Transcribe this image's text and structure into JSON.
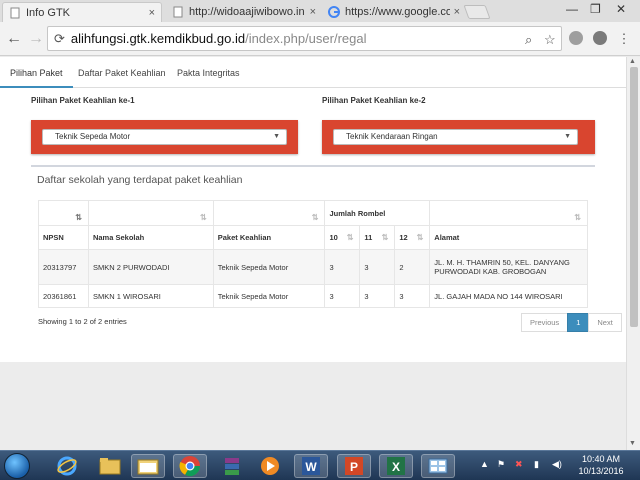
{
  "browser": {
    "tabs": [
      {
        "title": "Info GTK",
        "active": true
      },
      {
        "title": "http://widoaajiwibowo.in",
        "active": false
      },
      {
        "title": "https://www.google.co.id",
        "active": false
      }
    ],
    "close_glyph": "×",
    "url_host": "alihfungsi.gtk.kemdikbud.go.id",
    "url_path": "/index.php/user/regal"
  },
  "page": {
    "tabs": [
      "Pilihan Paket",
      "Daftar Paket Keahlian",
      "Pakta Integritas"
    ],
    "active_tab": 0,
    "choice1": {
      "label": "Pilihan Paket Keahlian ke-1",
      "value": "Teknik Sepeda Motor"
    },
    "choice2": {
      "label": "Pilihan Paket Keahlian ke-2",
      "value": "Teknik Kendaraan Ringan"
    },
    "list_title": "Daftar sekolah yang terdapat paket keahlian",
    "table": {
      "group_header": "Jumlah Rombel",
      "columns": [
        "NPSN",
        "Nama Sekolah",
        "Paket Keahlian",
        "10",
        "11",
        "12",
        "Alamat"
      ],
      "rows": [
        {
          "npsn": "20313797",
          "nama": "SMKN 2 PURWODADI",
          "paket": "Teknik Sepeda Motor",
          "r10": "3",
          "r11": "3",
          "r12": "2",
          "alamat": "JL. M. H. THAMRIN 50, KEL. DANYANG PURWODADI KAB. GROBOGAN"
        },
        {
          "npsn": "20361861",
          "nama": "SMKN 1 WIROSARI",
          "paket": "Teknik Sepeda Motor",
          "r10": "3",
          "r11": "3",
          "r12": "3",
          "alamat": "JL. GAJAH MADA NO 144 WIROSARI"
        }
      ]
    },
    "info": "Showing 1 to 2 of 2 entries",
    "pagination": {
      "previous": "Previous",
      "current": "1",
      "next": "Next"
    }
  },
  "taskbar": {
    "icons": [
      "start-orb",
      "internet-explorer-icon",
      "file-explorer-icon",
      "chrome-icon",
      "winrar-icon",
      "media-player-icon",
      "word-icon",
      "powerpoint-icon",
      "excel-icon",
      "control-panel-icon"
    ],
    "time": "10:40 AM",
    "date": "10/13/2016"
  },
  "colors": {
    "accent_red": "#d9452f",
    "accent_blue": "#3c8dbc"
  }
}
